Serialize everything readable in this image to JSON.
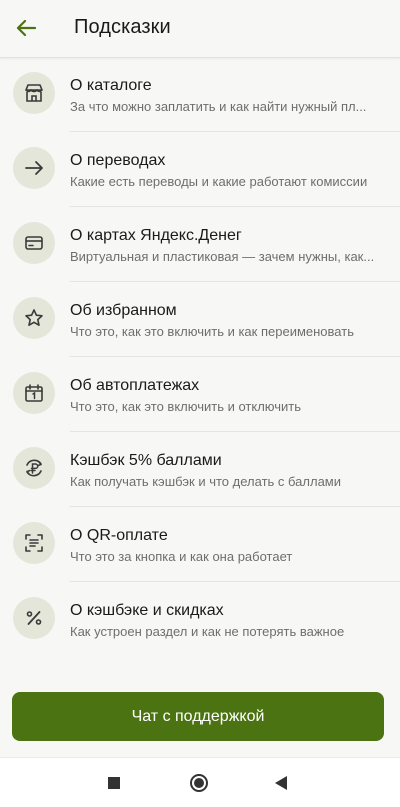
{
  "header": {
    "title": "Подсказки",
    "back_icon": "arrow-left-icon"
  },
  "items": [
    {
      "icon": "storefront-icon",
      "title": "О каталоге",
      "subtitle": "За что можно заплатить и как найти нужный пл..."
    },
    {
      "icon": "arrow-right-icon",
      "title": "О переводах",
      "subtitle": "Какие есть переводы и какие работают комиссии"
    },
    {
      "icon": "card-icon",
      "title": "О картах Яндекс.Денег",
      "subtitle": "Виртуальная и пластиковая — зачем нужны, как..."
    },
    {
      "icon": "star-icon",
      "title": "Об избранном",
      "subtitle": "Что это, как это включить и как переименовать"
    },
    {
      "icon": "calendar-icon",
      "title": "Об автоплатежах",
      "subtitle": "Что это, как это включить и отключить"
    },
    {
      "icon": "ruble-cashback-icon",
      "title": "Кэшбэк 5% баллами",
      "subtitle": "Как получать кэшбэк и что делать с баллами"
    },
    {
      "icon": "qr-scan-icon",
      "title": "О QR-оплате",
      "subtitle": "Что это за кнопка и как она работает"
    },
    {
      "icon": "percent-icon",
      "title": "О кэшбэке и скидках",
      "subtitle": "Как устроен раздел и как не потерять важное"
    }
  ],
  "chat_button": {
    "label": "Чат с поддержкой"
  },
  "navbar": {
    "recents_icon": "square-icon",
    "home_icon": "circle-icon",
    "back_icon": "triangle-back-icon"
  },
  "colors": {
    "accent": "#4c7312",
    "icon_bg": "#e3e6d9",
    "icon_stroke": "#3a3a3a"
  }
}
